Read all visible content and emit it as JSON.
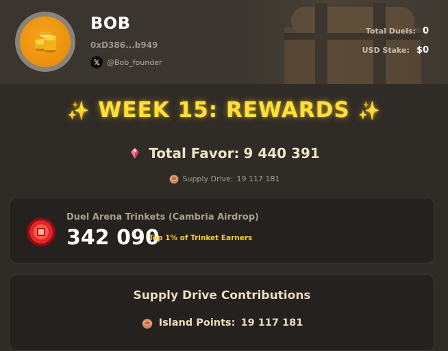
{
  "profile": {
    "username": "BOB",
    "wallet": "0xD386...b949",
    "x_handle": "@Bob_founder"
  },
  "stats": {
    "total_duels_label": "Total Duels:",
    "total_duels_value": "0",
    "usd_stake_label": "USD Stake:",
    "usd_stake_value": "$0"
  },
  "rewards": {
    "title": "WEEK 15: REWARDS",
    "total_favor_label": "Total Favor:",
    "total_favor_value": "9 440 391",
    "supply_drive_label": "Supply Drive:",
    "supply_drive_value": "19 117 181"
  },
  "trinkets": {
    "label": "Duel Arena Trinkets (Cambria Airdrop)",
    "value": "342 090",
    "rank": "Top 1% of Trinket Earners"
  },
  "contributions": {
    "title": "Supply Drive Contributions",
    "island_points_label": "Island Points:",
    "island_points_value": "19 117 181"
  },
  "icons": {
    "avatar": "gold-coins-icon",
    "x": "x-logo-icon",
    "sparkle": "sparkle-icon",
    "favor": "red-gem-icon",
    "supply": "pie-icon",
    "trinket": "red-medallion-icon"
  },
  "colors": {
    "accent": "#ffdf3a",
    "rank": "#ffd21a",
    "background": "#2f2b27",
    "card": "#24211e"
  }
}
